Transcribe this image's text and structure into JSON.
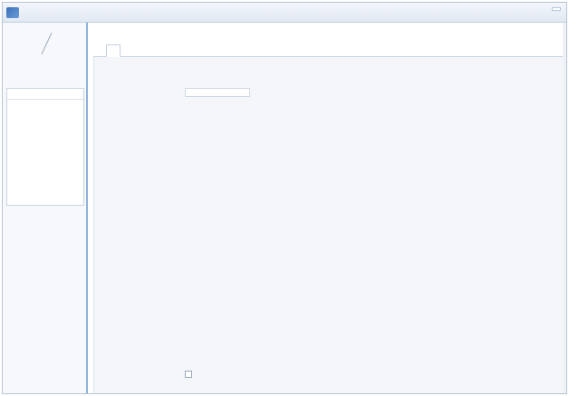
{
  "topbar": {
    "logo_text": "",
    "account": "",
    "links": [
      "",
      ""
    ],
    "right_items": [
      "",
      ""
    ]
  },
  "sidebar": {
    "quick_actions": [
      "",
      ""
    ],
    "compose_label": "",
    "panel_tabs": [
      "",
      "",
      ""
    ],
    "items": [
      {
        "label": "",
        "count": ""
      },
      {
        "label": "",
        "count": ""
      },
      {
        "label": "",
        "count": ""
      },
      {
        "label": "",
        "count": ""
      },
      {
        "label": "",
        "count": ""
      },
      {
        "label": "",
        "count": ""
      }
    ]
  },
  "main": {
    "page_title": "",
    "tabs": [
      "",
      "",
      "",
      "",
      "",
      "",
      "",
      "",
      "",
      ""
    ],
    "active_tab_index": 1,
    "sections": [
      {
        "title": "",
        "field_label": "",
        "field_value": "",
        "options": [
          {
            "label": "",
            "desc": ""
          },
          {
            "label": "",
            "desc": ""
          },
          {
            "label": "",
            "desc": ""
          }
        ]
      },
      {
        "title": "",
        "options": [
          {
            "label": "",
            "desc": ""
          },
          {
            "label": "",
            "desc": ""
          },
          {
            "label": "",
            "desc": ""
          },
          {
            "label": "",
            "desc": ""
          }
        ]
      },
      {
        "title": "",
        "checkbox_label": "",
        "checkbox_desc": ""
      }
    ]
  },
  "colors": {
    "link": "#3b63b3",
    "sidebar_border": "#8fb1dc",
    "content_bg": "#f4f6f9"
  }
}
